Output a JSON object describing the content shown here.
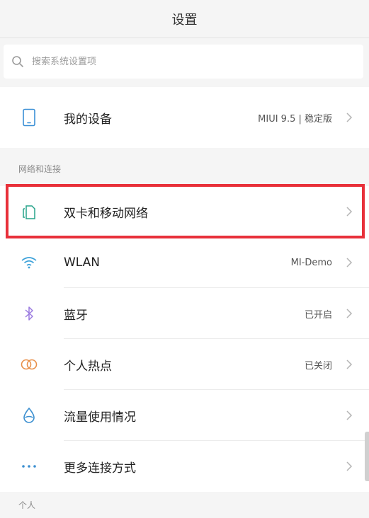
{
  "header": {
    "title": "设置"
  },
  "search": {
    "placeholder": "搜索系统设置项"
  },
  "device": {
    "label": "我的设备",
    "value": "MIUI 9.5 | 稳定版",
    "icon": "phone-icon"
  },
  "sections": {
    "network": {
      "title": "网络和连接",
      "items": [
        {
          "label": "双卡和移动网络",
          "value": "",
          "icon": "dual-sim-icon"
        },
        {
          "label": "WLAN",
          "value": "MI-Demo",
          "icon": "wifi-icon"
        },
        {
          "label": "蓝牙",
          "value": "已开启",
          "icon": "bluetooth-icon"
        },
        {
          "label": "个人热点",
          "value": "已关闭",
          "icon": "hotspot-icon"
        },
        {
          "label": "流量使用情况",
          "value": "",
          "icon": "data-usage-icon"
        },
        {
          "label": "更多连接方式",
          "value": "",
          "icon": "more-dots-icon"
        }
      ]
    },
    "personal": {
      "title": "个人"
    }
  },
  "colors": {
    "highlight": "#e8303a",
    "device_icon": "#3a8fd6",
    "sim_icon": "#26a38a",
    "wifi_icon": "#3aa0d9",
    "bluetooth_icon": "#9b7be0",
    "hotspot_icon": "#e8904a",
    "data_icon": "#3b8fd0",
    "more_icon": "#3b8fd0"
  }
}
